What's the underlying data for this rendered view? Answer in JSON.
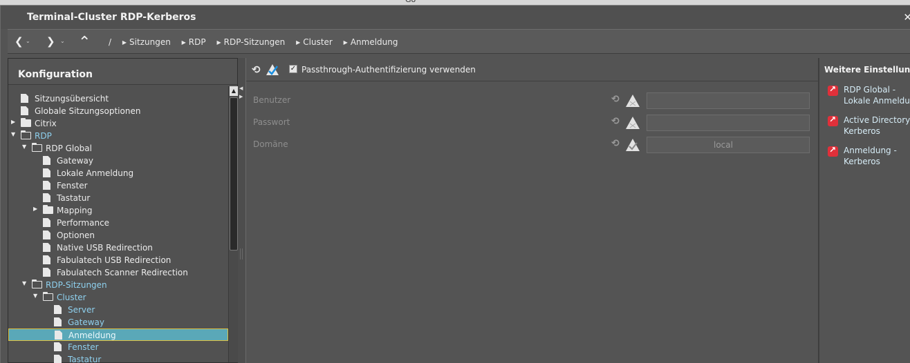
{
  "topstrip": {
    "text": "Go"
  },
  "window": {
    "title": "Terminal-Cluster RDP-Kerberos",
    "close_label": "✕"
  },
  "toolbar": {
    "back_label": "❮",
    "forward_label": "❯",
    "up_label": "⌃",
    "dropdown_label": "⌄",
    "root_sep": "/",
    "breadcrumbs": [
      "Sitzungen",
      "RDP",
      "RDP-Sitzungen",
      "Cluster",
      "Anmeldung"
    ]
  },
  "left": {
    "title": "Konfiguration",
    "tree": [
      {
        "label": "Sitzungsübersicht",
        "icon": "doc",
        "indent": 0,
        "expander": ""
      },
      {
        "label": "Globale Sitzungsoptionen",
        "icon": "doc",
        "indent": 0,
        "expander": ""
      },
      {
        "label": "Citrix",
        "icon": "folder",
        "indent": 0,
        "expander": "▶"
      },
      {
        "label": "RDP",
        "icon": "folder-open",
        "indent": 0,
        "expander": "▼",
        "blue": true
      },
      {
        "label": "RDP Global",
        "icon": "folder-open",
        "indent": 1,
        "expander": "▼"
      },
      {
        "label": "Gateway",
        "icon": "doc",
        "indent": 2,
        "expander": ""
      },
      {
        "label": "Lokale Anmeldung",
        "icon": "doc",
        "indent": 2,
        "expander": ""
      },
      {
        "label": "Fenster",
        "icon": "doc",
        "indent": 2,
        "expander": ""
      },
      {
        "label": "Tastatur",
        "icon": "doc",
        "indent": 2,
        "expander": ""
      },
      {
        "label": "Mapping",
        "icon": "folder",
        "indent": 2,
        "expander": "▶"
      },
      {
        "label": "Performance",
        "icon": "doc",
        "indent": 2,
        "expander": ""
      },
      {
        "label": "Optionen",
        "icon": "doc",
        "indent": 2,
        "expander": ""
      },
      {
        "label": "Native USB Redirection",
        "icon": "doc",
        "indent": 2,
        "expander": ""
      },
      {
        "label": "Fabulatech USB Redirection",
        "icon": "doc",
        "indent": 2,
        "expander": ""
      },
      {
        "label": "Fabulatech Scanner Redirection",
        "icon": "doc",
        "indent": 2,
        "expander": ""
      },
      {
        "label": "RDP-Sitzungen",
        "icon": "folder-open",
        "indent": 1,
        "expander": "▼",
        "blue": true
      },
      {
        "label": "Cluster",
        "icon": "folder-open",
        "indent": 2,
        "expander": "▼",
        "blue": true
      },
      {
        "label": "Server",
        "icon": "doc",
        "indent": 3,
        "expander": "",
        "blue": true
      },
      {
        "label": "Gateway",
        "icon": "doc",
        "indent": 3,
        "expander": "",
        "blue": true
      },
      {
        "label": "Anmeldung",
        "icon": "doc",
        "indent": 3,
        "expander": "",
        "blue": true,
        "selected": true
      },
      {
        "label": "Fenster",
        "icon": "doc",
        "indent": 3,
        "expander": "",
        "blue": true
      },
      {
        "label": "Tastatur",
        "icon": "doc",
        "indent": 3,
        "expander": "",
        "blue": true
      }
    ]
  },
  "center": {
    "passthrough": {
      "label": "Passthrough-Authentifizierung verwenden",
      "checked": true,
      "check_mark": "✓"
    },
    "fields": [
      {
        "label": "Benutzer",
        "value": "",
        "status": "warning"
      },
      {
        "label": "Passwort",
        "value": "",
        "status": "warning"
      },
      {
        "label": "Domäne",
        "value": "local",
        "status": "ok"
      }
    ]
  },
  "right": {
    "title": "Weitere Einstellungen",
    "links": [
      {
        "lines": [
          "RDP Global -",
          "Lokale Anmeldu..."
        ]
      },
      {
        "lines": [
          "Active Directory /",
          "Kerberos"
        ]
      },
      {
        "lines": [
          "Anmeldung -",
          "Kerberos"
        ]
      }
    ]
  }
}
